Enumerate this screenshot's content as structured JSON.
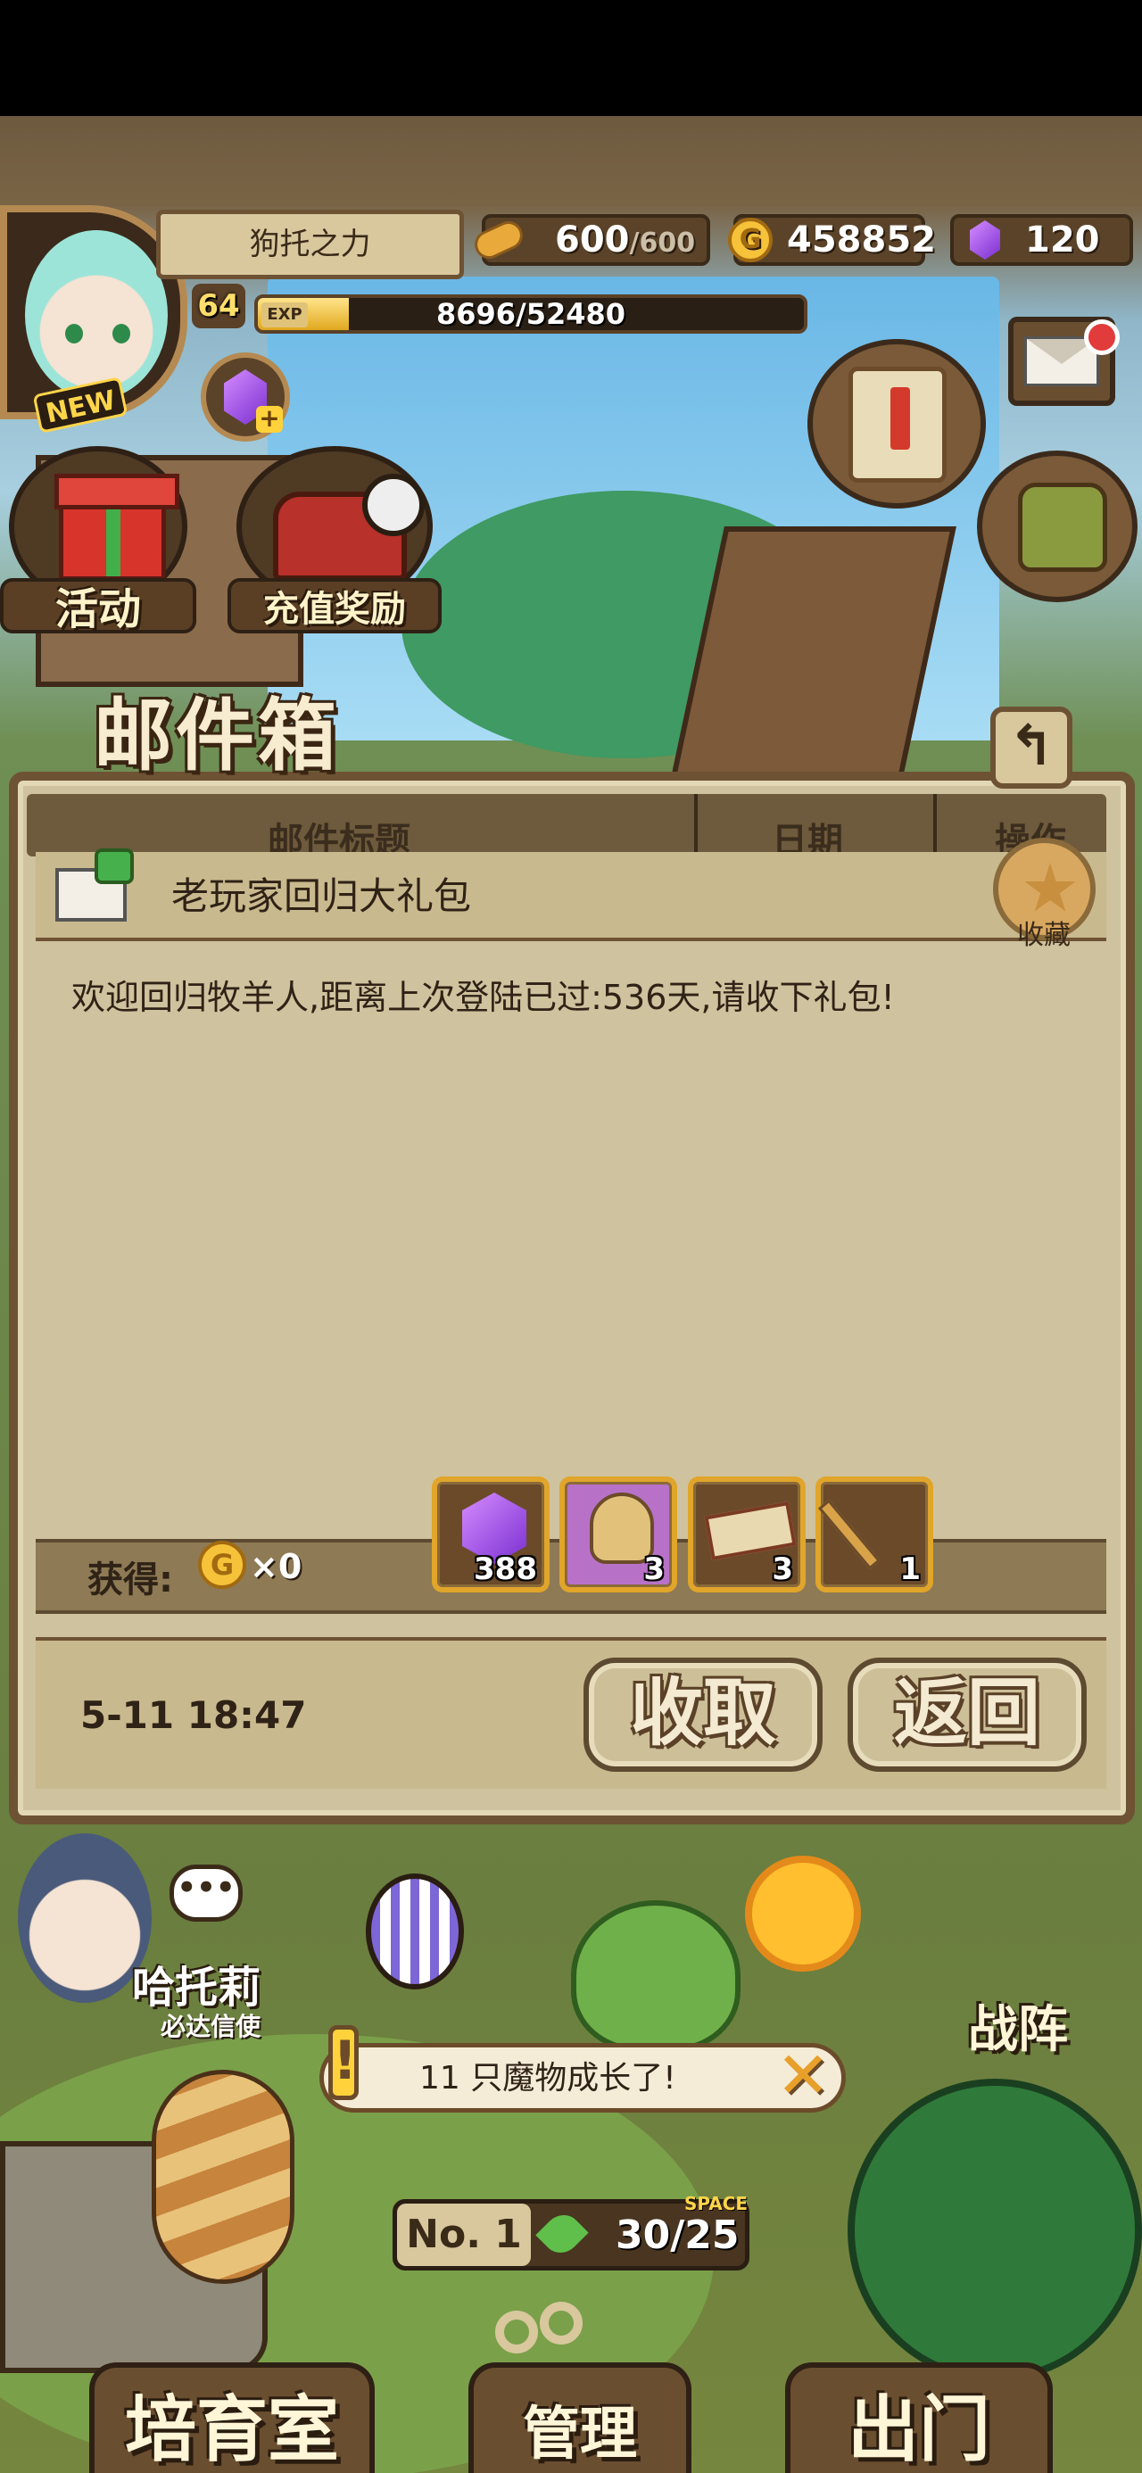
{
  "hud": {
    "player_name": "狗托之力",
    "level": "64",
    "new_badge": "NEW",
    "exp_tag": "EXP",
    "exp_text": "8696/52480",
    "exp_fraction": 0.166,
    "bread": "600",
    "bread_max": "/600",
    "gold": "458852",
    "gold_glyph": "G",
    "gems": "120",
    "gem_add_glyph": "+"
  },
  "features": {
    "activity_label": "活动",
    "recharge_label": "充值奖励"
  },
  "mailbox": {
    "title": "邮件箱",
    "back_glyph": "↰",
    "columns": [
      "邮件标题",
      "日期",
      "操作"
    ],
    "subject": "老玩家回归大礼包",
    "favorite_label": "收藏",
    "body": "欢迎回归牧羊人,距离上次登陆已过:536天,请收下礼包!",
    "gain_label": "获得:",
    "gain_coin_glyph": "G",
    "gain_count": "×0",
    "items": [
      {
        "icon": "gem-icon",
        "count": "388"
      },
      {
        "icon": "sack-icon",
        "count": "3"
      },
      {
        "icon": "ticket-icon",
        "count": "3"
      },
      {
        "icon": "key-icon",
        "count": "1"
      }
    ],
    "date": "5-11 18:47",
    "collect_label": "收取",
    "return_label": "返回"
  },
  "bottom": {
    "helper_name": "哈托莉",
    "helper_role": "必达信使",
    "helper_bubble": "•••",
    "lineup_label": "战阵",
    "notice_bang": "!",
    "notice_text": "11 只魔物成长了!",
    "notice_close": "✕",
    "ranch_no": "No. 1",
    "space_tag": "SPACE",
    "capacity": "30/25",
    "nav": {
      "nursery": "培育室",
      "manage": "管理",
      "outing": "出门"
    }
  },
  "colors": {
    "panel_bg": "#cfc29e",
    "panel_border": "#6e5234",
    "accent_gold": "#e0a52a",
    "text_dark": "#2f2216"
  }
}
